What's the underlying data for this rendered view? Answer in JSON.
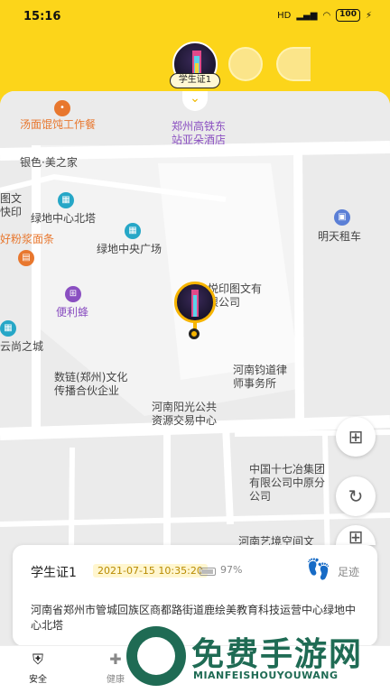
{
  "status_bar": {
    "time": "15:16",
    "signal": "HD",
    "battery": "100"
  },
  "avatars": {
    "selected_label": "学生证1"
  },
  "map": {
    "pois": [
      {
        "id": "tangmian",
        "text": "汤面馄饨工作餐"
      },
      {
        "id": "zhengzhou-hotel",
        "text": "郑州高铁东站亚朵酒店"
      },
      {
        "id": "yinse",
        "text": "银色·美之家"
      },
      {
        "id": "tuwen",
        "text": "图文快印"
      },
      {
        "id": "lvdi-north",
        "text": "绿地中心北塔"
      },
      {
        "id": "fenjiang",
        "text": "好粉浆面条"
      },
      {
        "id": "lvdi-plaza",
        "text": "绿地中央广场"
      },
      {
        "id": "mingtian",
        "text": "明天租车"
      },
      {
        "id": "yueyin",
        "text": "悦印图文有限公司"
      },
      {
        "id": "bianlifeng",
        "text": "便利蜂"
      },
      {
        "id": "yunshang",
        "text": "云尚之城"
      },
      {
        "id": "shulian",
        "text": "数链(郑州)文化传播合伙企业"
      },
      {
        "id": "junyi",
        "text": "河南钧道律师事务所"
      },
      {
        "id": "yangguang",
        "text": "河南阳光公共资源交易中心"
      },
      {
        "id": "zhongye",
        "text": "中国十七冶集团有限公司中原分公司"
      },
      {
        "id": "yizhi",
        "text": "河南艺境空间文"
      }
    ]
  },
  "card": {
    "name": "学生证1",
    "time": "2021-07-15 10:35:20",
    "battery": "97%",
    "footprint_label": "足迹",
    "address": "河南省郑州市管城回族区商都路街道鹿绘美教育科技运营中心绿地中心北塔"
  },
  "tabbar": {
    "items": [
      {
        "label": "安全"
      },
      {
        "label": "健康"
      }
    ]
  },
  "watermark": {
    "title": "免费手游网",
    "subtitle": "MIANFEISHOUYOUWANG"
  },
  "colors": {
    "brand_yellow": "#fcd51a",
    "accent_orange": "#e8772e",
    "watermark_green": "#1f6b54"
  }
}
